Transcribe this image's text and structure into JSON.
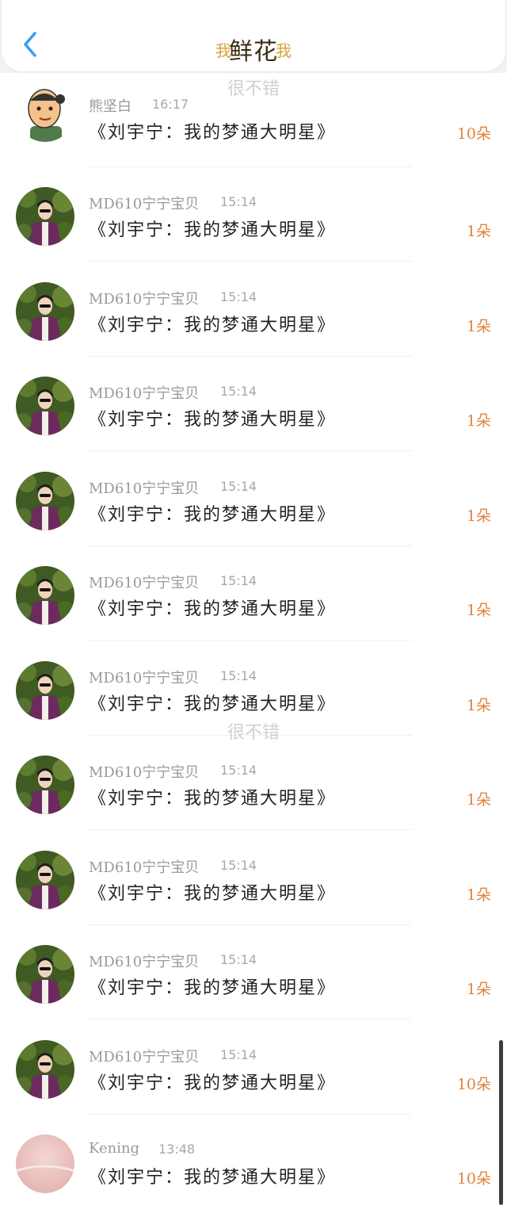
{
  "header": {
    "title": "鲜花",
    "deco_left": "我",
    "deco_right": "我",
    "back_icon": "chevron-left-icon"
  },
  "watermarks": [
    "很不错",
    "很不错"
  ],
  "colors": {
    "accent": "#3b9cf0",
    "count": "#e0833e"
  },
  "items": [
    {
      "avatar": "cartoon-avatar",
      "name": "熊坚白",
      "time": "16:17",
      "message": "《刘宇宁：我的梦通大明星》",
      "count": "10朵"
    },
    {
      "avatar": "photo-avatar",
      "name": "MD610宁宁宝贝",
      "time": "15:14",
      "message": "《刘宇宁：我的梦通大明星》",
      "count": "1朵"
    },
    {
      "avatar": "photo-avatar",
      "name": "MD610宁宁宝贝",
      "time": "15:14",
      "message": "《刘宇宁：我的梦通大明星》",
      "count": "1朵"
    },
    {
      "avatar": "photo-avatar",
      "name": "MD610宁宁宝贝",
      "time": "15:14",
      "message": "《刘宇宁：我的梦通大明星》",
      "count": "1朵"
    },
    {
      "avatar": "photo-avatar",
      "name": "MD610宁宁宝贝",
      "time": "15:14",
      "message": "《刘宇宁：我的梦通大明星》",
      "count": "1朵"
    },
    {
      "avatar": "photo-avatar",
      "name": "MD610宁宁宝贝",
      "time": "15:14",
      "message": "《刘宇宁：我的梦通大明星》",
      "count": "1朵"
    },
    {
      "avatar": "photo-avatar",
      "name": "MD610宁宁宝贝",
      "time": "15:14",
      "message": "《刘宇宁：我的梦通大明星》",
      "count": "1朵"
    },
    {
      "avatar": "photo-avatar",
      "name": "MD610宁宁宝贝",
      "time": "15:14",
      "message": "《刘宇宁：我的梦通大明星》",
      "count": "1朵"
    },
    {
      "avatar": "photo-avatar",
      "name": "MD610宁宁宝贝",
      "time": "15:14",
      "message": "《刘宇宁：我的梦通大明星》",
      "count": "1朵"
    },
    {
      "avatar": "photo-avatar",
      "name": "MD610宁宁宝贝",
      "time": "15:14",
      "message": "《刘宇宁：我的梦通大明星》",
      "count": "1朵"
    },
    {
      "avatar": "photo-avatar",
      "name": "MD610宁宁宝贝",
      "time": "15:14",
      "message": "《刘宇宁：我的梦通大明星》",
      "count": "10朵"
    },
    {
      "avatar": "pink-avatar",
      "name": "Kening",
      "time": "13:48",
      "message": "《刘宇宁：我的梦通大明星》",
      "count": "10朵"
    }
  ]
}
